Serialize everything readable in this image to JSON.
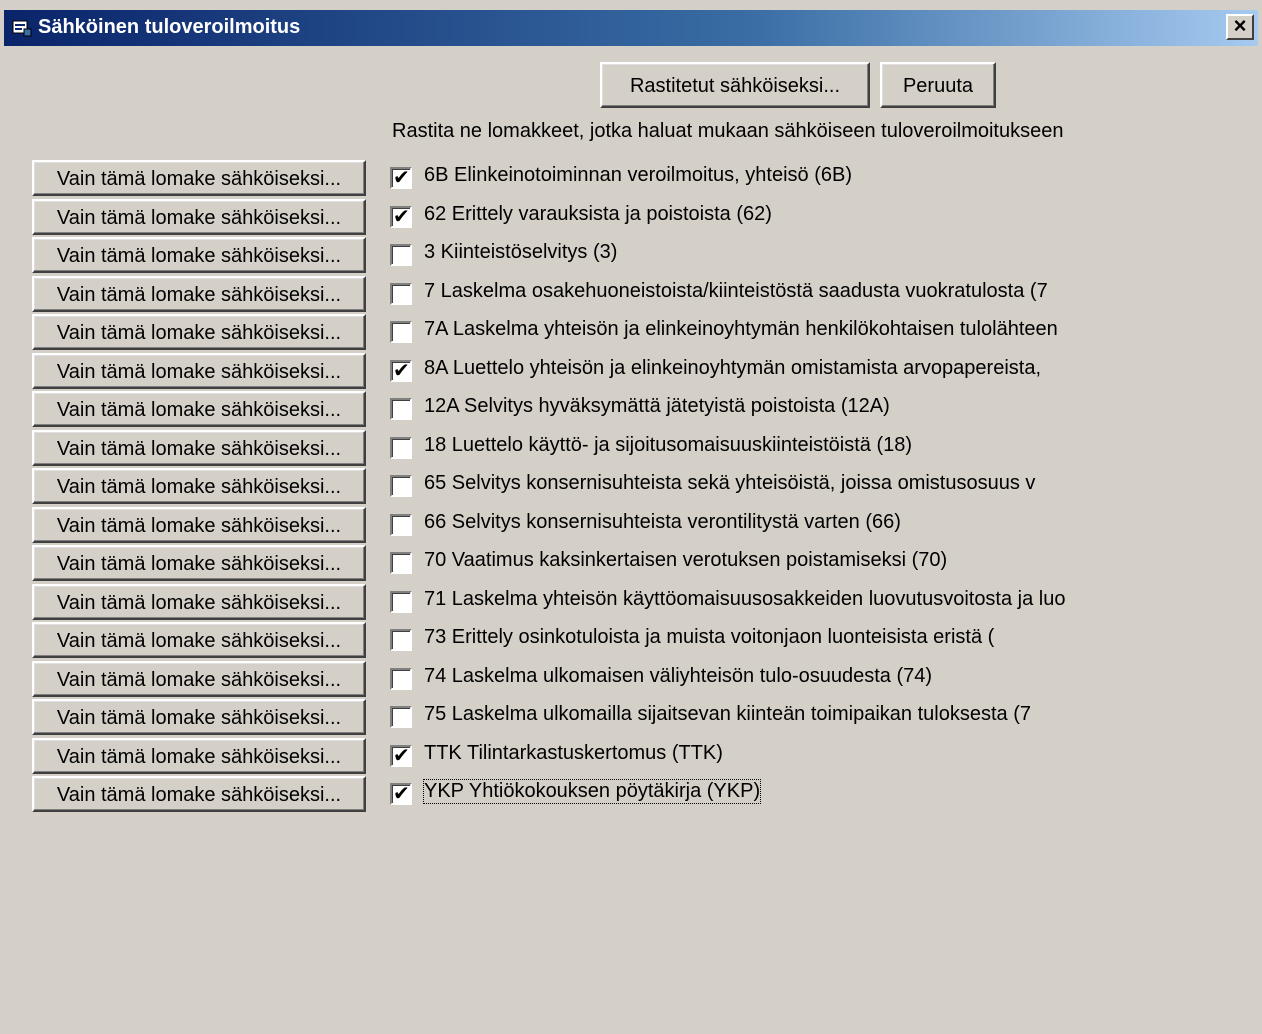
{
  "window": {
    "title": "Sähköinen tuloveroilmoitus",
    "close_label": "×"
  },
  "top_buttons": {
    "submit_checked": "Rastitetut sähköiseksi...",
    "cancel": "Peruuta"
  },
  "instruction": "Rastita ne lomakkeet, jotka haluat mukaan sähköiseen tuloveroilmoitukseen",
  "row_button_label": "Vain tämä lomake sähköiseksi...",
  "forms": [
    {
      "code": "6B",
      "label": "6B  Elinkeinotoiminnan veroilmoitus, yhteisö (6B)",
      "checked": true
    },
    {
      "code": "62",
      "label": "62  Erittely varauksista ja poistoista (62)",
      "checked": true
    },
    {
      "code": "3",
      "label": "3  Kiinteistöselvitys (3)",
      "checked": false
    },
    {
      "code": "7",
      "label": "7  Laskelma osakehuoneistoista/kiinteistöstä saadusta vuokratulosta (7",
      "checked": false
    },
    {
      "code": "7A",
      "label": "7A  Laskelma yhteisön ja elinkeinoyhtymän henkilökohtaisen tulolähteen",
      "checked": false
    },
    {
      "code": "8A",
      "label": "8A  Luettelo yhteisön ja elinkeinoyhtymän omistamista arvopapereista,",
      "checked": true
    },
    {
      "code": "12A",
      "label": "12A  Selvitys hyväksymättä jätetyistä poistoista (12A)",
      "checked": false
    },
    {
      "code": "18",
      "label": "18  Luettelo käyttö- ja sijoitusomaisuuskiinteistöistä (18)",
      "checked": false
    },
    {
      "code": "65",
      "label": "65  Selvitys konsernisuhteista sekä yhteisöistä, joissa omistusosuus v",
      "checked": false
    },
    {
      "code": "66",
      "label": "66  Selvitys konsernisuhteista verontilitystä varten (66)",
      "checked": false
    },
    {
      "code": "70",
      "label": "70  Vaatimus kaksinkertaisen verotuksen poistamiseksi (70)",
      "checked": false
    },
    {
      "code": "71",
      "label": "71  Laskelma yhteisön käyttöomaisuusosakkeiden luovutusvoitosta ja luo",
      "checked": false
    },
    {
      "code": "73",
      "label": "73  Erittely osinkotuloista ja muista voitonjaon luonteisista eristä (",
      "checked": false
    },
    {
      "code": "74",
      "label": "74  Laskelma ulkomaisen väliyhteisön tulo-osuudesta (74)",
      "checked": false
    },
    {
      "code": "75",
      "label": "75  Laskelma ulkomailla sijaitsevan kiinteän toimipaikan tuloksesta (7",
      "checked": false
    },
    {
      "code": "TTK",
      "label": "TTK  Tilintarkastuskertomus (TTK)",
      "checked": true
    },
    {
      "code": "YKP",
      "label": "YKP  Yhtiökokouksen pöytäkirja (YKP)",
      "checked": true
    }
  ],
  "colors": {
    "face": "#d4d0c8",
    "title_start": "#0a246a",
    "title_end": "#a6caf0"
  }
}
